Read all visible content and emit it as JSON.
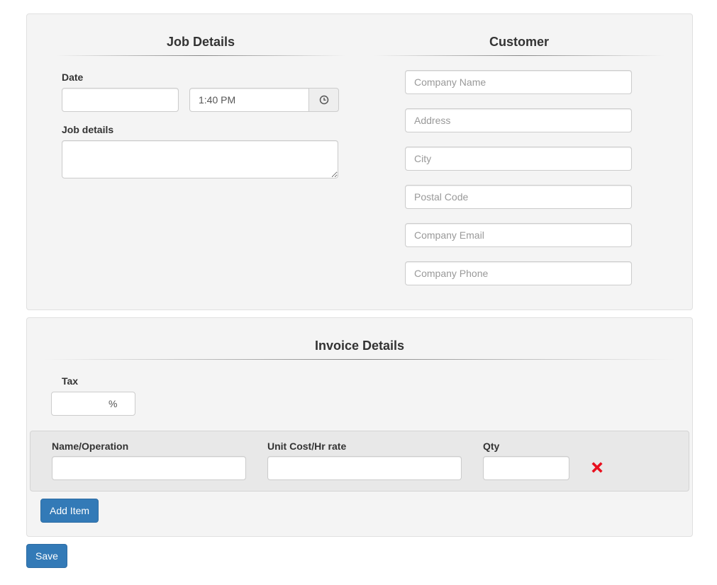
{
  "job_details": {
    "title": "Job Details",
    "date_label": "Date",
    "date_value": "",
    "time_value": "1:40 PM",
    "time_icon": "clock-icon",
    "job_details_label": "Job details",
    "job_details_value": ""
  },
  "customer": {
    "title": "Customer",
    "fields": [
      {
        "placeholder": "Company Name",
        "value": ""
      },
      {
        "placeholder": "Address",
        "value": ""
      },
      {
        "placeholder": "City",
        "value": ""
      },
      {
        "placeholder": "Postal Code",
        "value": ""
      },
      {
        "placeholder": "Company Email",
        "value": ""
      },
      {
        "placeholder": "Company Phone",
        "value": ""
      }
    ]
  },
  "invoice": {
    "title": "Invoice Details",
    "tax_label": "Tax",
    "tax_value": "",
    "tax_suffix": "%",
    "columns": [
      "Name/Operation",
      "Unit Cost/Hr rate",
      "Qty"
    ],
    "items": [
      {
        "name": "",
        "unit_cost": "",
        "qty": ""
      }
    ],
    "remove_icon": "remove-icon",
    "remove_color": "#e8101e",
    "add_item_label": "Add Item"
  },
  "save_label": "Save",
  "colors": {
    "primary": "#337ab7",
    "panel_bg": "#f4f4f4",
    "danger": "#e8101e"
  }
}
